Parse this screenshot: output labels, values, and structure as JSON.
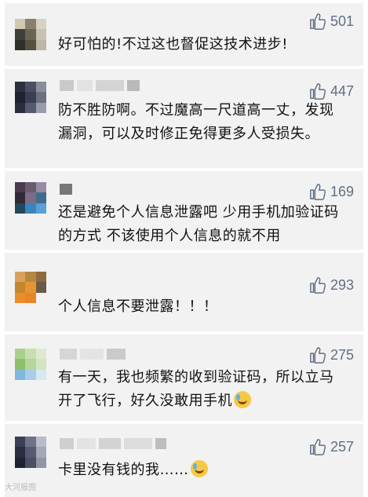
{
  "comments": [
    {
      "likes": "501",
      "text": "好可怕的!不过这也督促这技术进步!"
    },
    {
      "likes": "447",
      "text": "防不胜防啊。不过魔高一尺道高一丈，发现漏洞，可以及时修正免得更多人受损失。"
    },
    {
      "likes": "169",
      "text": "还是避免个人信息泄露吧  少用手机加验证码的方式  不该使用个人信息的就不用"
    },
    {
      "likes": "293",
      "text": "个人信息不要泄露！！！"
    },
    {
      "likes": "275",
      "text": "有一天，我也频繁的收到验证码，所以立马开了飞行，好久没敢用手机"
    },
    {
      "likes": "257",
      "text": "卡里没有钱的我……"
    }
  ],
  "watermark": "大河报图",
  "icons": {
    "like": "thumbs-up-icon",
    "emoji": "crying-laughing-emoji-icon"
  },
  "colors": {
    "card_bg": "#f2f2f2",
    "like_color": "#5f6f84"
  }
}
